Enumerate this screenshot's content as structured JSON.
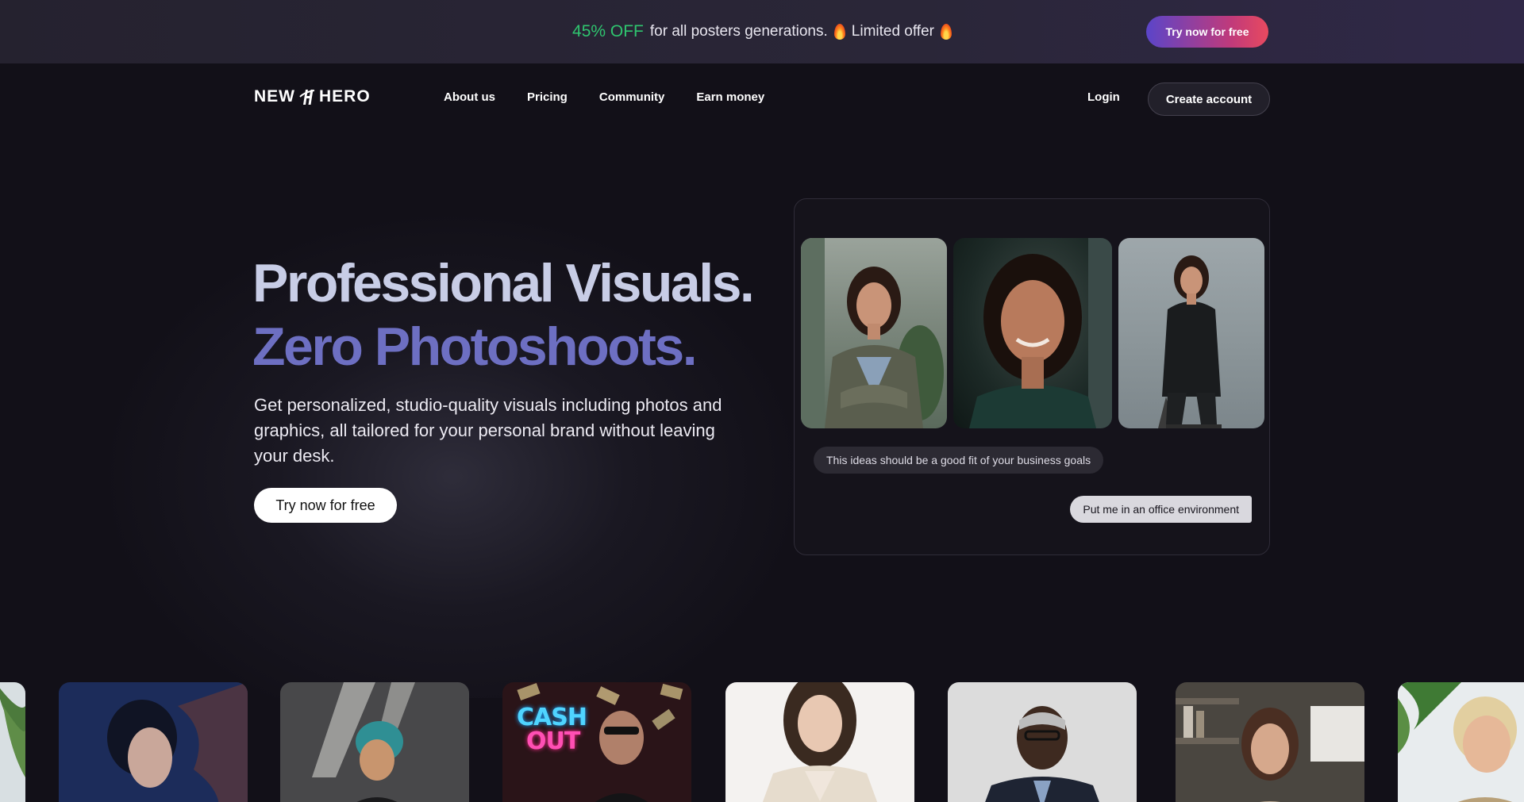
{
  "promo": {
    "discount": "45% OFF",
    "text": "for all posters generations.",
    "limited": "Limited offer",
    "cta": "Try now for free"
  },
  "nav": {
    "logo_left": "NEW",
    "logo_right": "HERO",
    "links": [
      "About us",
      "Pricing",
      "Community",
      "Earn money"
    ],
    "login": "Login",
    "create_account": "Create account"
  },
  "hero": {
    "headline_1": "Professional Visuals.",
    "headline_2": "Zero Photoshoots.",
    "description": "Get personalized, studio-quality visuals including photos and graphics, all tailored for your personal brand without leaving your desk.",
    "cta": "Try now for free"
  },
  "demo": {
    "bubble_1": "This ideas should be a good fit of your business goals",
    "bubble_2": "Put me in an office environment"
  },
  "gallery": {
    "cash_line_1": "CASH",
    "cash_line_2": "OUT"
  },
  "colors": {
    "accent_green": "#2fc56f",
    "headline_light": "#c8cde6",
    "headline_purple": "#6d6fc2",
    "cta_gradient_start": "#5b45c9",
    "cta_gradient_end": "#e84a5f"
  }
}
